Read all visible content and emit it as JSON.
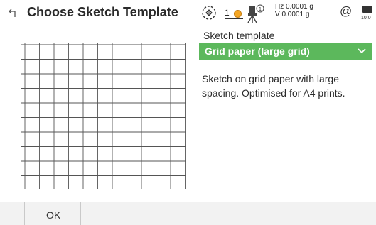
{
  "header": {
    "title": "Choose Sketch Template",
    "back_icon": "back-arrow-icon"
  },
  "status": {
    "satellite_icon": "satellite-icon",
    "position_count": "1",
    "instrument_icon": "instrument-icon",
    "instrument_badge": "1",
    "hz": "Hz 0.0001 g",
    "v": "V  0.0001 g",
    "at_symbol": "@",
    "battery_icon": "battery-icon",
    "time": "10:0"
  },
  "main": {
    "template_label": "Sketch template",
    "template_value": "Grid paper (large grid)",
    "description": "Sketch on grid paper with large spacing. Optimised for A4 prints."
  },
  "preview": {
    "columns": 11,
    "rows": 10
  },
  "footer": {
    "ok_label": "OK"
  },
  "colors": {
    "accent": "#5cb85c",
    "footer_bg": "#f2f2f2"
  }
}
